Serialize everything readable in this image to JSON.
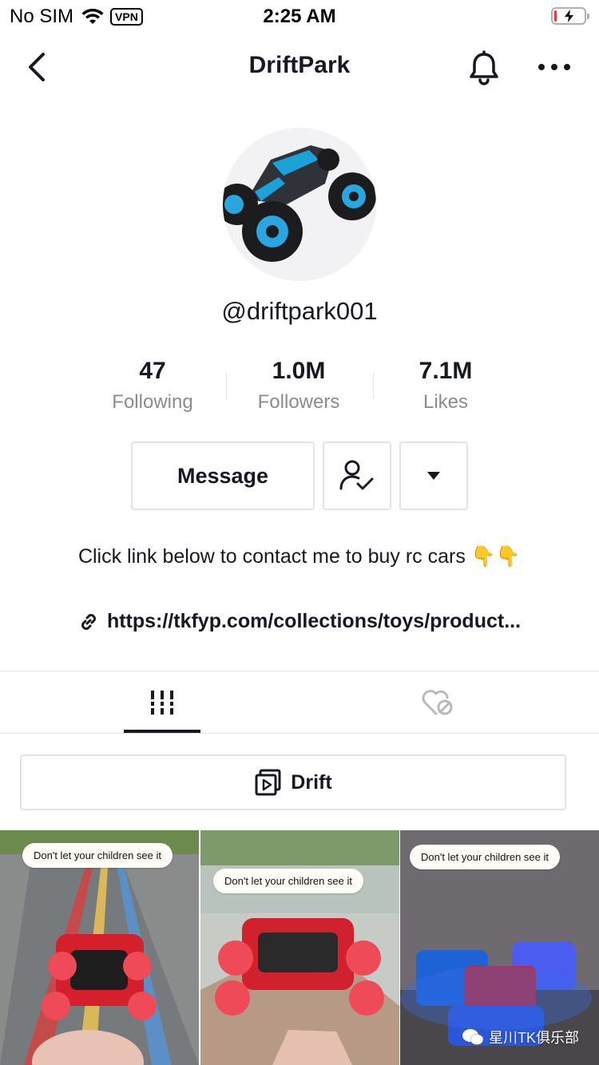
{
  "status_bar": {
    "carrier": "No SIM",
    "vpn": "VPN",
    "time": "2:25 AM",
    "battery_level": 0.08,
    "charging": true
  },
  "nav": {
    "title": "DriftPark",
    "icons": [
      "back-icon",
      "bell-icon",
      "more-icon"
    ]
  },
  "profile": {
    "username": "@driftpark001",
    "stats": [
      {
        "value": "47",
        "label": "Following"
      },
      {
        "value": "1.0M",
        "label": "Followers"
      },
      {
        "value": "7.1M",
        "label": "Likes"
      }
    ],
    "message_label": "Message",
    "bio": "Click link below to contact me to buy rc cars 👇👇",
    "link": "https://tkfyp.com/collections/toys/product..."
  },
  "tabs": [
    {
      "icon": "grid-icon",
      "active": true
    },
    {
      "icon": "liked-hidden-icon",
      "active": false
    }
  ],
  "playlist": {
    "label": "Drift"
  },
  "videos": [
    {
      "caption": "Don't let your children see it"
    },
    {
      "caption": "Don't let your children see it"
    },
    {
      "caption": "Don't let your children see it"
    }
  ],
  "watermark": "星川TK俱乐部",
  "colors": {
    "text": "#161823",
    "secondary": "#8a8b91",
    "border": "#e3e3e4",
    "battery_low": "#e03a3a"
  }
}
